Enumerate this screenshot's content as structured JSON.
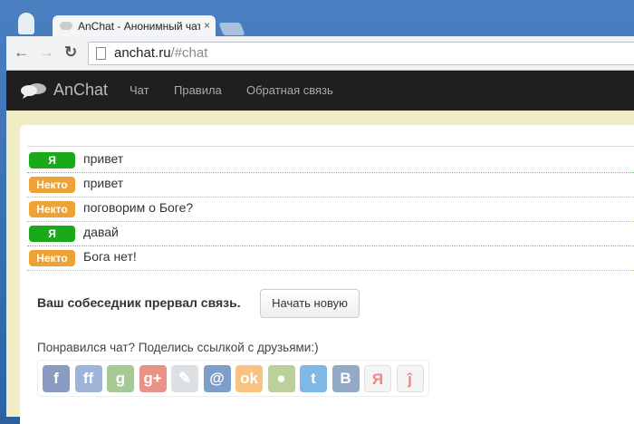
{
  "browser": {
    "tab_title": "AnChat - Анонимный чат",
    "tab_close": "×",
    "url_host": "anchat.ru",
    "url_path": "/#chat",
    "back": "←",
    "forward": "→",
    "reload": "↻"
  },
  "navbar": {
    "brand": "AnChat",
    "links": [
      "Чат",
      "Правила",
      "Обратная связь"
    ]
  },
  "messages": [
    {
      "sender": "Я",
      "text": "привет",
      "type": "me"
    },
    {
      "sender": "Некто",
      "text": "привет",
      "type": "other"
    },
    {
      "sender": "Некто",
      "text": "поговорим о Боге?",
      "type": "other"
    },
    {
      "sender": "Я",
      "text": "давай",
      "type": "me"
    },
    {
      "sender": "Некто",
      "text": "Бога нет!",
      "type": "other"
    }
  ],
  "status": {
    "text": "Ваш собеседник прервал связь.",
    "button": "Начать новую"
  },
  "share": {
    "text": "Понравился чат? Поделись ссылкой с друзьями:)",
    "icons": [
      {
        "name": "facebook",
        "glyph": "f",
        "color": "#3b5998"
      },
      {
        "name": "friendfeed",
        "glyph": "ff",
        "color": "#5f85c0"
      },
      {
        "name": "google",
        "glyph": "g",
        "color": "#6aa84f"
      },
      {
        "name": "google-plus",
        "glyph": "g+",
        "color": "#dd4b39"
      },
      {
        "name": "livejournal",
        "glyph": "✎",
        "color": "#c8ccd2"
      },
      {
        "name": "mail-ru",
        "glyph": "@",
        "color": "#2a5ea8"
      },
      {
        "name": "odnoklassniki",
        "glyph": "ok",
        "color": "#f59a2c"
      },
      {
        "name": "moi-krug",
        "glyph": "●",
        "color": "#8fb35a"
      },
      {
        "name": "twitter",
        "glyph": "t",
        "color": "#2a8bd6"
      },
      {
        "name": "vkontakte",
        "glyph": "B",
        "color": "#4c75a3"
      },
      {
        "name": "yandex",
        "glyph": "Я",
        "color": "#eeeeee"
      },
      {
        "name": "yaru",
        "glyph": "ĵ",
        "color": "#eeeeee"
      }
    ]
  }
}
